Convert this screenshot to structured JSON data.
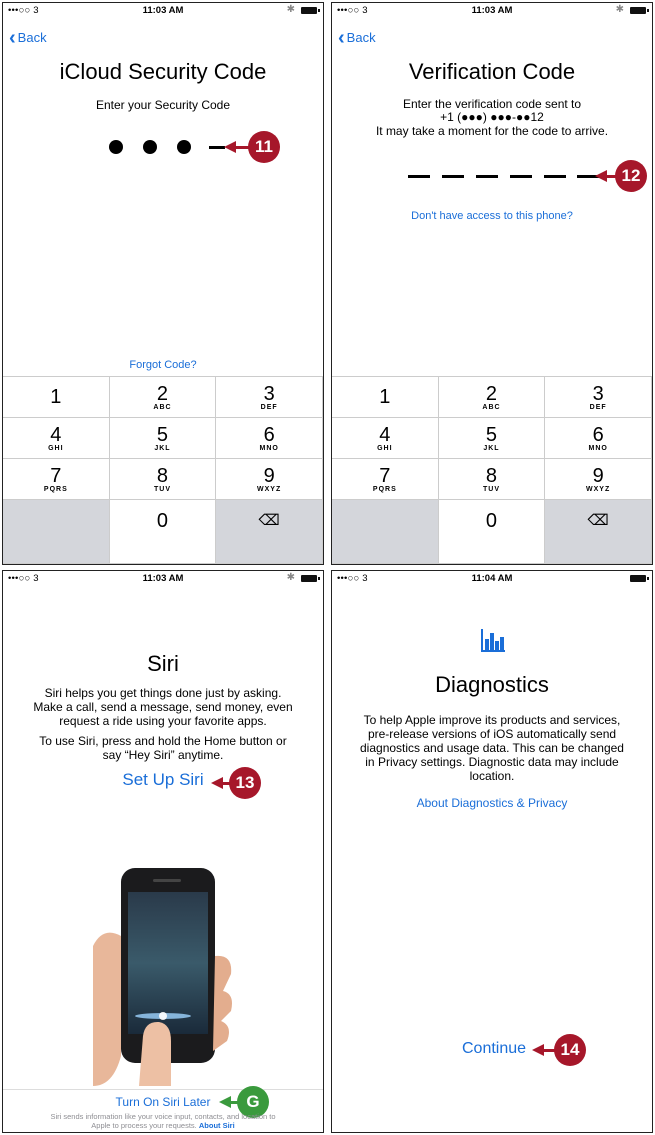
{
  "status_time": [
    "11:03 AM",
    "11:03 AM",
    "11:03 AM",
    "11:04 AM"
  ],
  "status_carrier": "•••○○ 3",
  "screen1": {
    "back": "Back",
    "title": "iCloud Security Code",
    "subtitle": "Enter your Security Code",
    "forgot": "Forgot Code?",
    "callout": "11"
  },
  "screen2": {
    "back": "Back",
    "title": "Verification Code",
    "line1": "Enter the verification code sent to",
    "line2": "+1 (●●●) ●●●-●●12",
    "line3": "It may take a moment for the code to arrive.",
    "no_access": "Don't have access to this phone?",
    "callout": "12"
  },
  "keypad": {
    "keys": [
      {
        "n": "1",
        "s": ""
      },
      {
        "n": "2",
        "s": "ABC"
      },
      {
        "n": "3",
        "s": "DEF"
      },
      {
        "n": "4",
        "s": "GHI"
      },
      {
        "n": "5",
        "s": "JKL"
      },
      {
        "n": "6",
        "s": "MNO"
      },
      {
        "n": "7",
        "s": "PQRS"
      },
      {
        "n": "8",
        "s": "TUV"
      },
      {
        "n": "9",
        "s": "WXYZ"
      },
      {
        "n": "",
        "s": ""
      },
      {
        "n": "0",
        "s": ""
      },
      {
        "n": "⌫",
        "s": ""
      }
    ]
  },
  "screen3": {
    "title": "Siri",
    "p1a": "Siri helps you get things done just by asking.",
    "p1b": "Make a call, send a message, send money, even",
    "p1c": "request a ride using your favorite apps.",
    "p2a": "To use Siri, press and hold the Home button or",
    "p2b": "say “Hey Siri” anytime.",
    "setup": "Set Up Siri",
    "later": "Turn On Siri Later",
    "foot1": "Siri sends information like your voice input, contacts, and location to",
    "foot2": "Apple to process your requests.",
    "about_siri": "About Siri",
    "callout": "13",
    "callout_g": "G"
  },
  "screen4": {
    "title": "Diagnostics",
    "p1": "To help Apple improve its products and services,",
    "p2": "pre-release versions of iOS automatically send",
    "p3": "diagnostics and usage data. This can be changed",
    "p4": "in Privacy settings. Diagnostic data may include",
    "p5": "location.",
    "about": "About Diagnostics & Privacy",
    "continue": "Continue",
    "callout": "14"
  },
  "colors": {
    "link": "#1a6ed8",
    "callout_red": "#a6172a",
    "callout_green": "#3a9a3d"
  }
}
